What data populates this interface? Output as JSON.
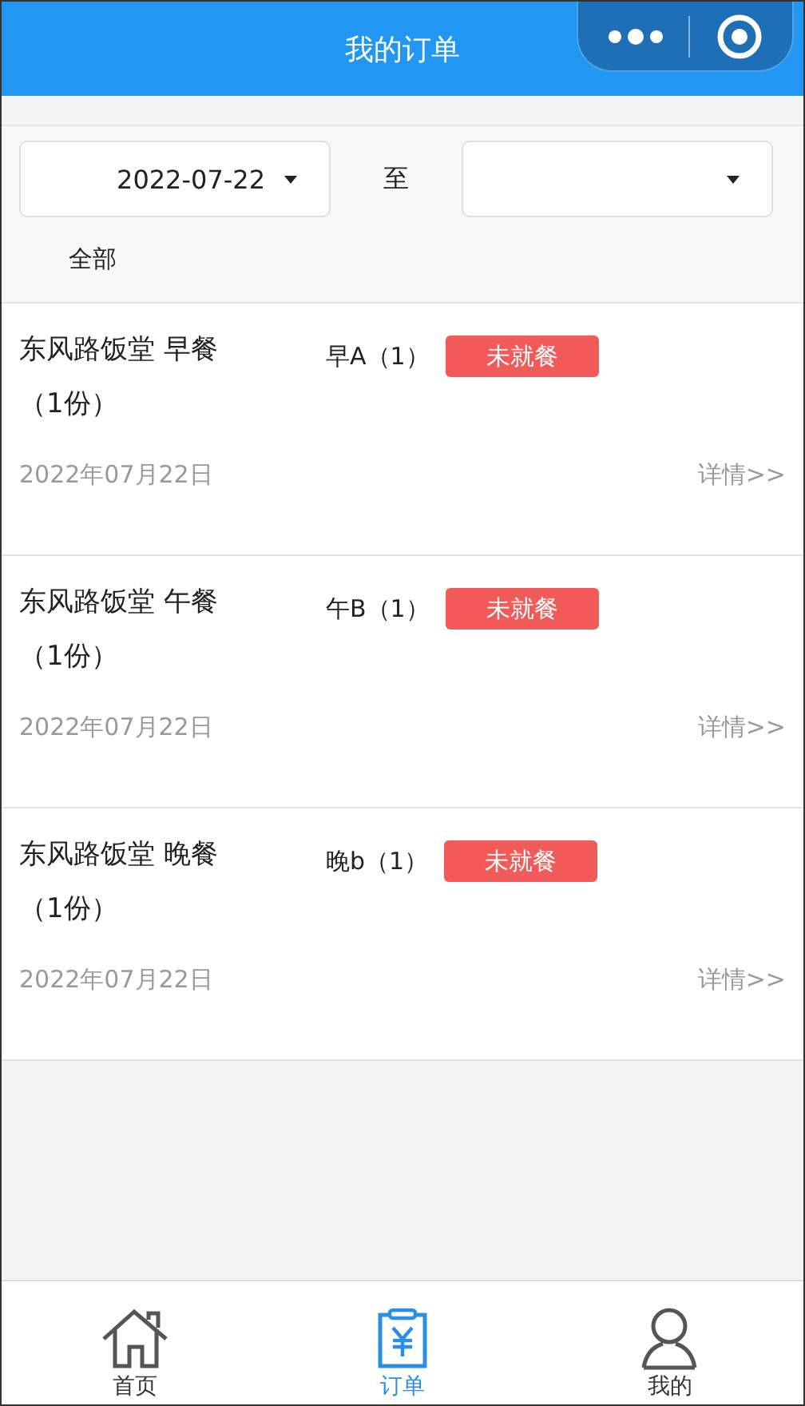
{
  "header": {
    "title": "我的订单"
  },
  "filter": {
    "start_date": "2022-07-22",
    "separator": "至",
    "category": "全部"
  },
  "orders": [
    {
      "title": "东风路饭堂 早餐",
      "portions": "（1份）",
      "item": "早A（1）",
      "status": "未就餐",
      "date": "2022年07月22日",
      "link": "详情>>"
    },
    {
      "title": "东风路饭堂 午餐",
      "portions": "（1份）",
      "item": "午B（1）",
      "status": "未就餐",
      "date": "2022年07月22日",
      "link": "详情>>"
    },
    {
      "title": "东风路饭堂 晚餐",
      "portions": "（1份）",
      "item": "晚b（1）",
      "status": "未就餐",
      "date": "2022年07月22日",
      "link": "详情>>"
    }
  ],
  "tab_bar": [
    {
      "label": "首页",
      "kind": "home",
      "selected": false
    },
    {
      "label": "订单",
      "kind": "order",
      "selected": true
    },
    {
      "label": "我的",
      "kind": "user",
      "selected": false
    }
  ]
}
